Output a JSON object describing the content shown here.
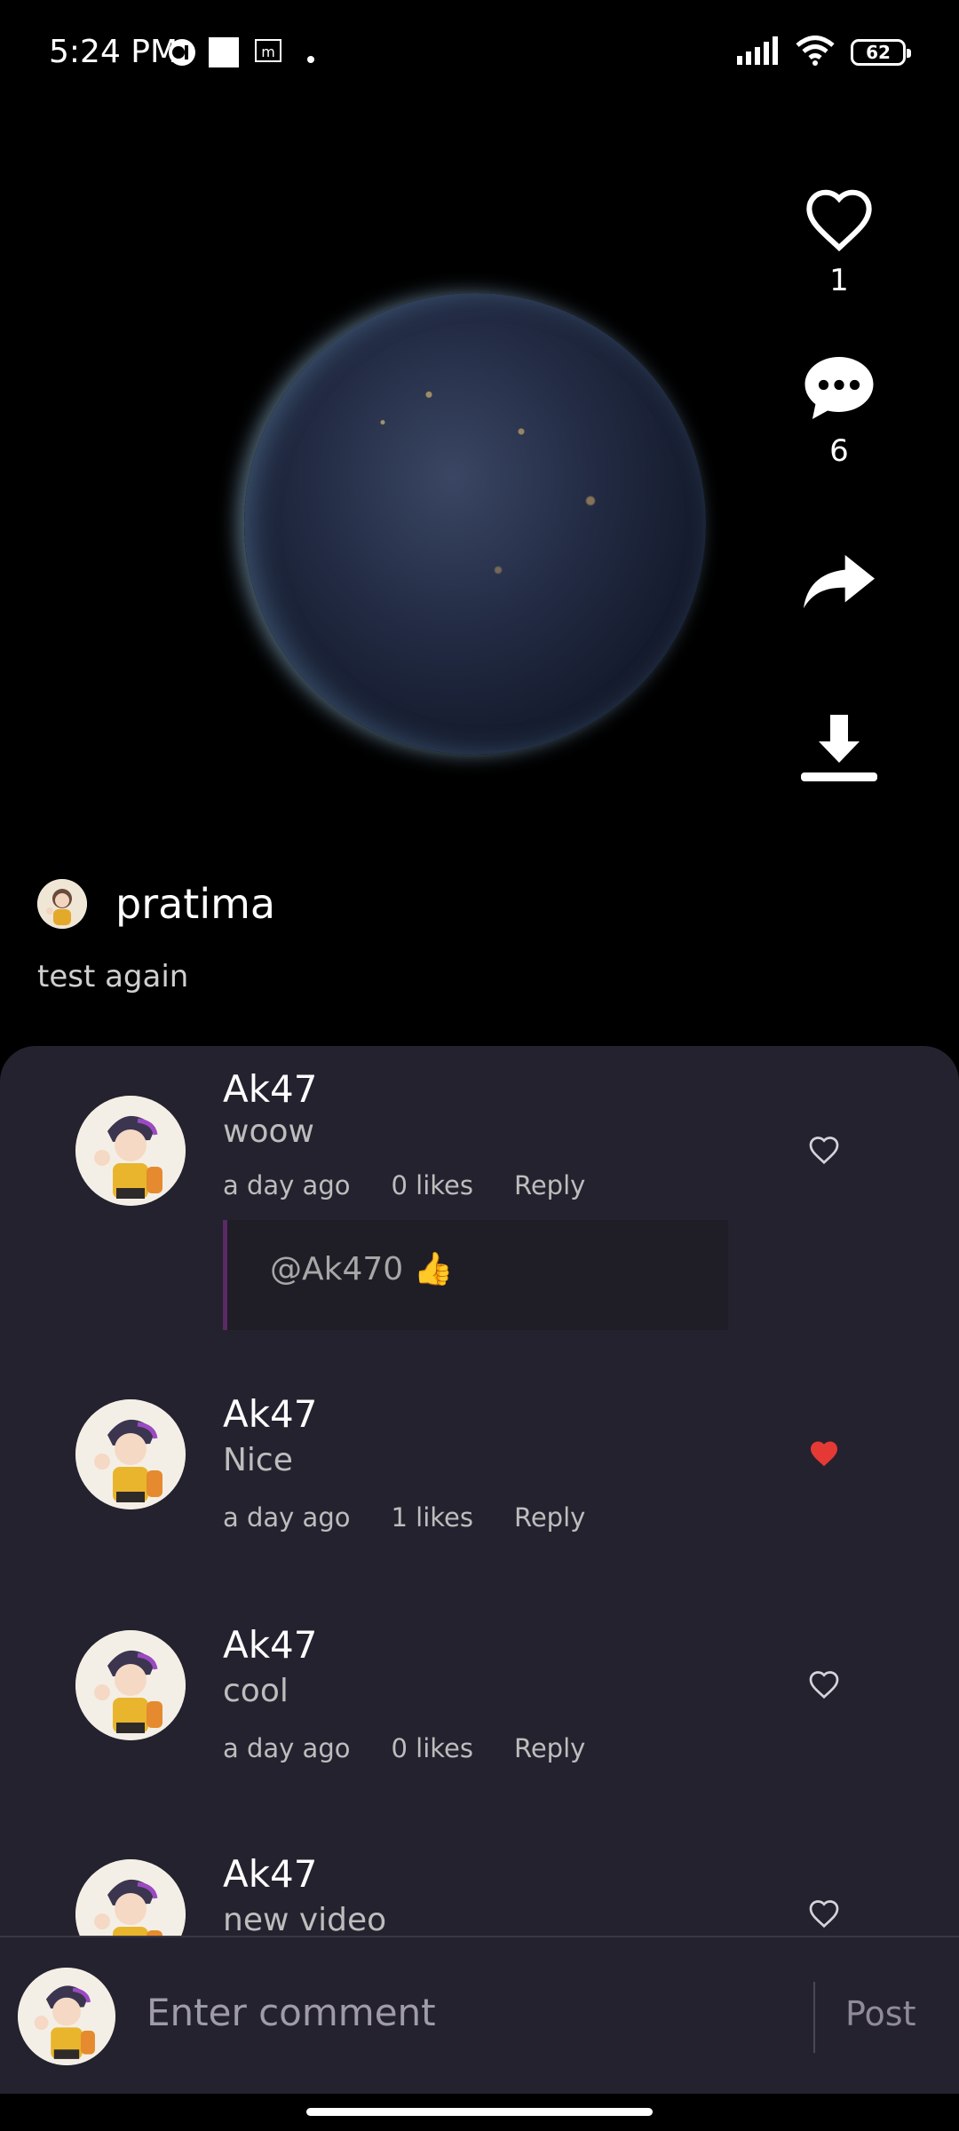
{
  "status_bar": {
    "time": "5:24 PM",
    "battery": "62"
  },
  "post": {
    "likes_count": "1",
    "comments_count": "6",
    "author": "pratima",
    "caption": "test again"
  },
  "comments": [
    {
      "user": "Ak47",
      "text": "woow",
      "time": "a day ago",
      "likes": "0 likes",
      "reply_label": "Reply",
      "liked": false,
      "reply_preview": "@Ak470 👍"
    },
    {
      "user": "Ak47",
      "text": "Nice",
      "time": "a day ago",
      "likes": "1 likes",
      "reply_label": "Reply",
      "liked": true
    },
    {
      "user": "Ak47",
      "text": "cool",
      "time": "a day ago",
      "likes": "0 likes",
      "reply_label": "Reply",
      "liked": false
    },
    {
      "user": "Ak47",
      "text": "new video",
      "liked": false
    }
  ],
  "comment_input": {
    "placeholder": "Enter comment",
    "post_label": "Post"
  },
  "colors": {
    "sheet_bg": "#25222f",
    "liked_heart": "#e53935",
    "reply_border": "#5a2a64"
  }
}
